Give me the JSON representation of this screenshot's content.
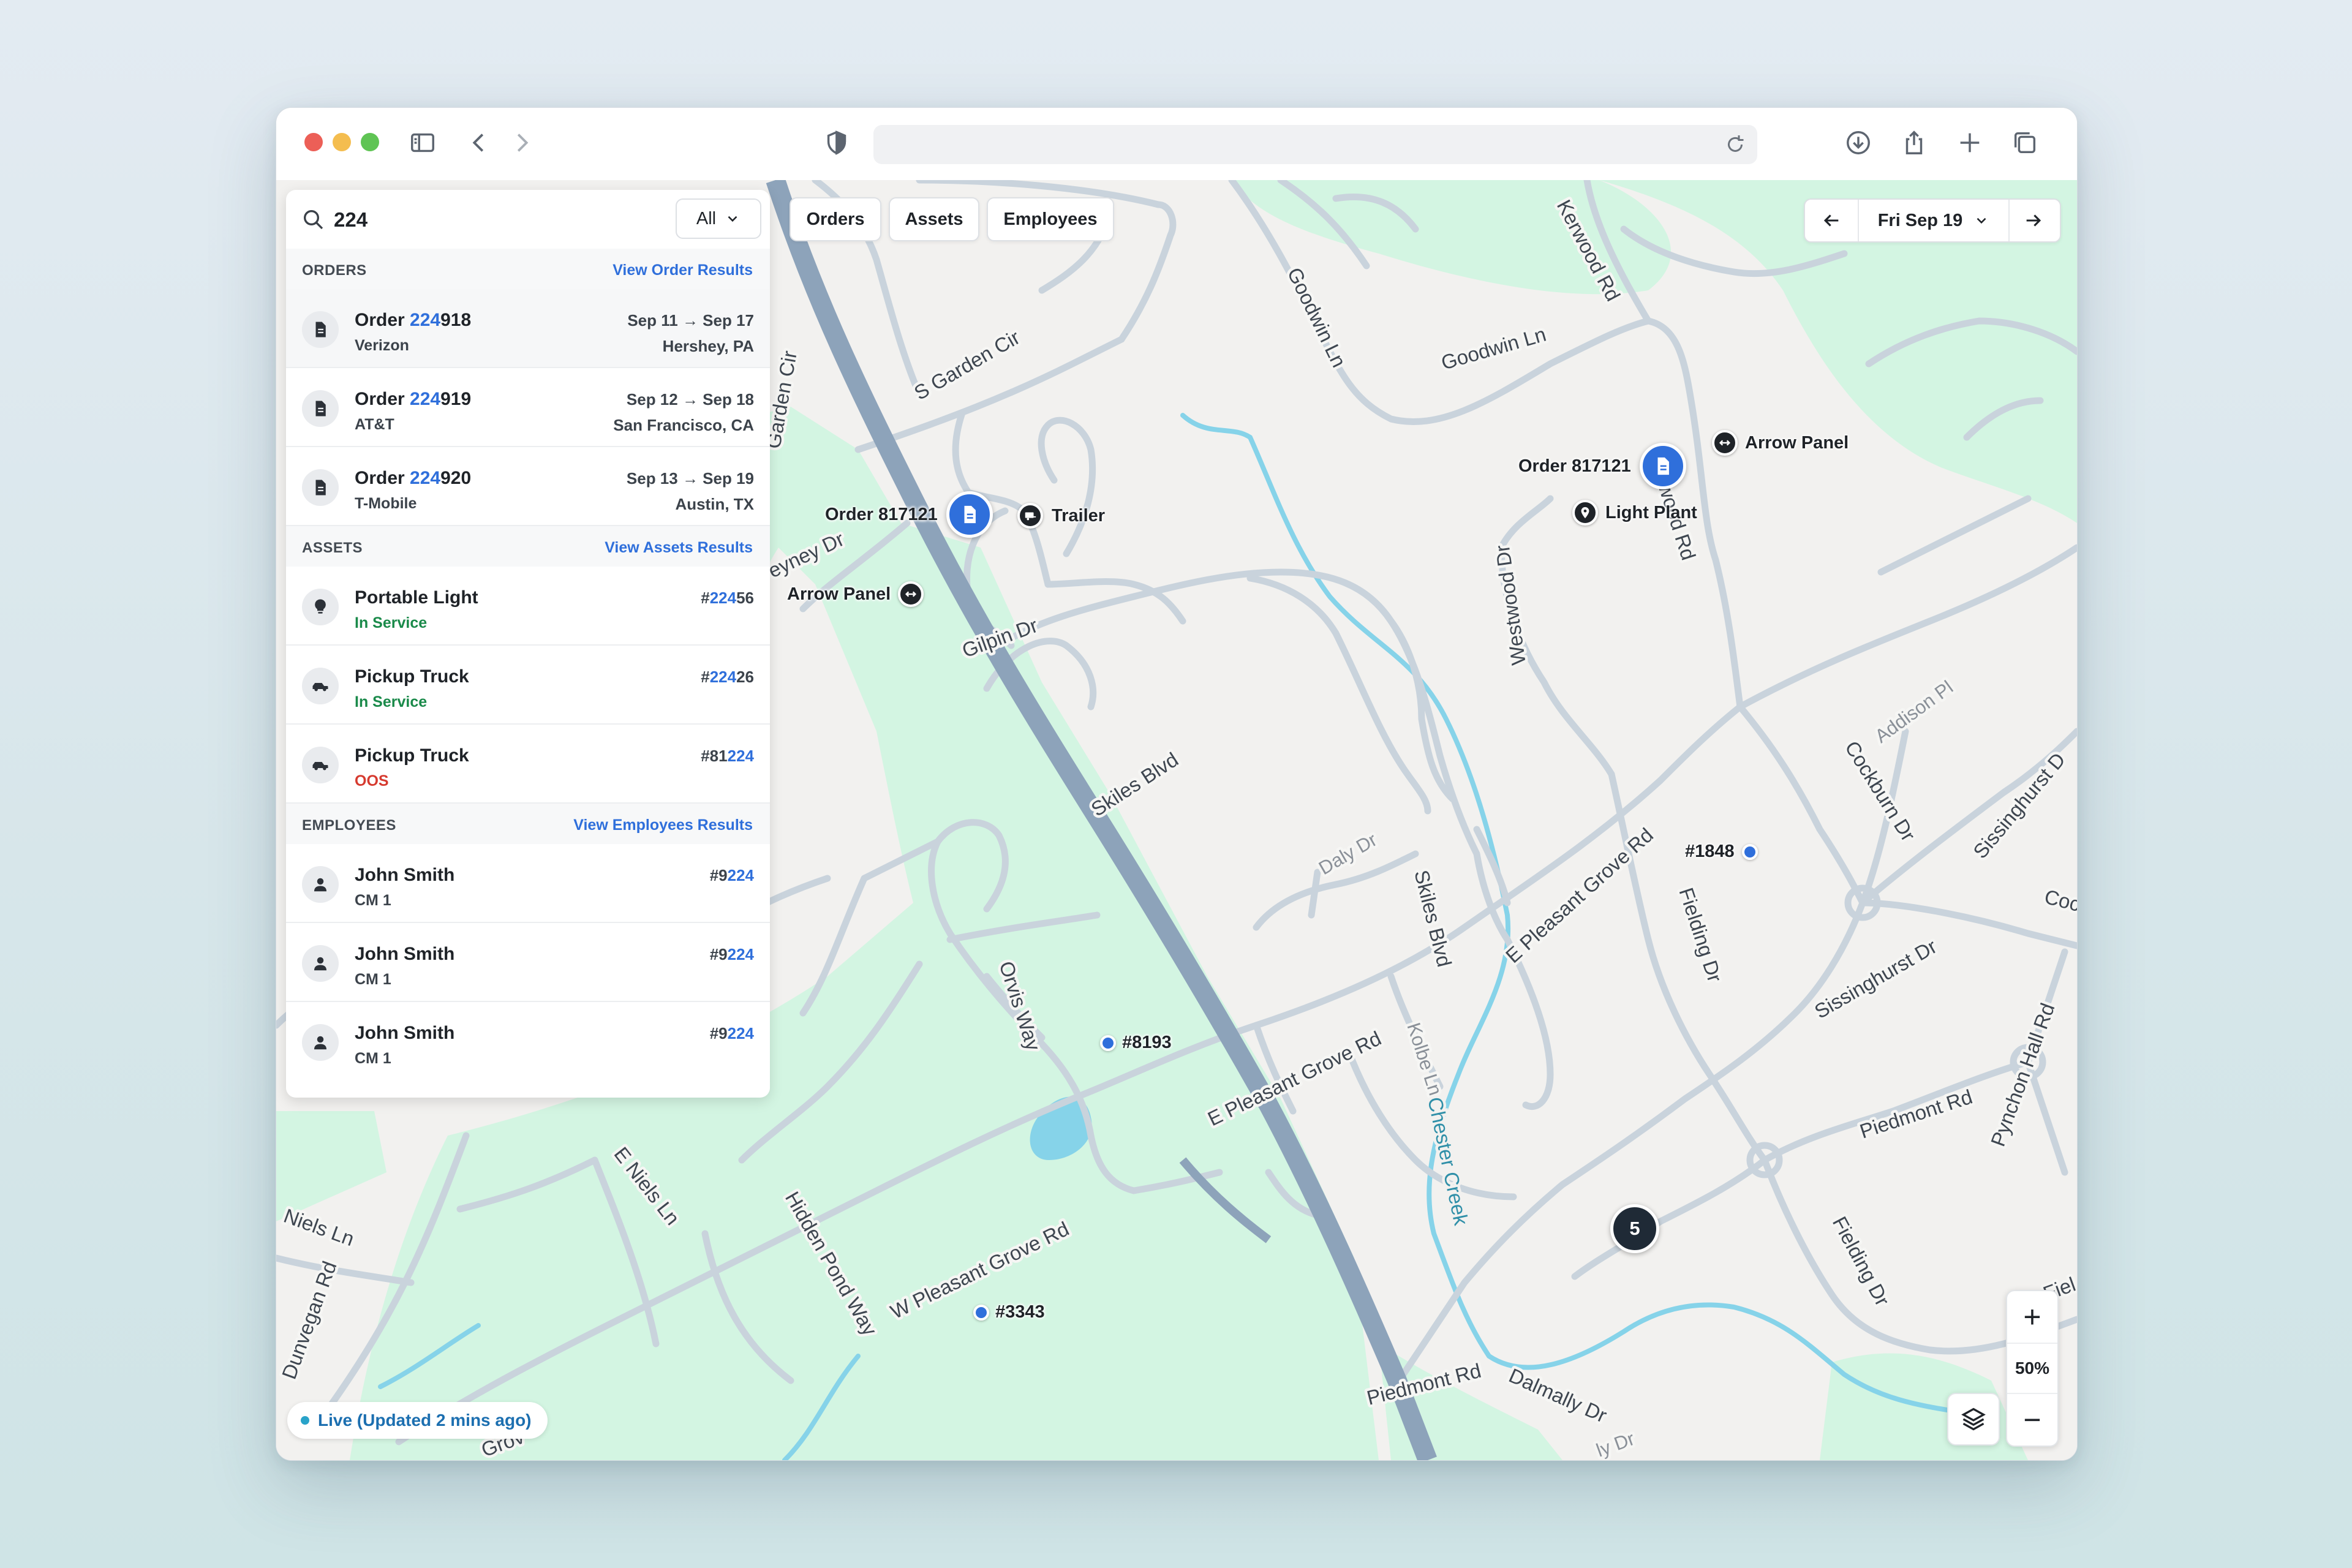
{
  "search": {
    "query": "224",
    "filter": "All"
  },
  "sections": {
    "orders": {
      "title": "ORDERS",
      "link": "View Order Results"
    },
    "assets": {
      "title": "ASSETS",
      "link": "View Assets Results"
    },
    "employees": {
      "title": "EMPLOYEES",
      "link": "View Employees Results"
    }
  },
  "orders": [
    {
      "prefix": "Order ",
      "hl": "224",
      "rest": "918",
      "sub": "Verizon",
      "dates": "Sep 11 → Sep 17",
      "place": "Hershey, PA"
    },
    {
      "prefix": "Order ",
      "hl": "224",
      "rest": "919",
      "sub": "AT&T",
      "dates": "Sep 12 → Sep 18",
      "place": "San Francisco, CA"
    },
    {
      "prefix": "Order ",
      "hl": "224",
      "rest": "920",
      "sub": "T-Mobile",
      "dates": "Sep 13 → Sep 19",
      "place": "Austin, TX"
    }
  ],
  "assets": [
    {
      "name": "Portable Light",
      "status": "In Service",
      "idpre": "#",
      "idhl": "224",
      "idrest": "56"
    },
    {
      "name": "Pickup Truck",
      "status": "In Service",
      "idpre": "#",
      "idhl": "224",
      "idrest": "26"
    },
    {
      "name": "Pickup Truck",
      "status": "OOS",
      "idpre": "#81",
      "idhl": "224",
      "idrest": ""
    }
  ],
  "employees": [
    {
      "name": "John Smith",
      "role": "CM 1",
      "idpre": "#9",
      "idhl": "224",
      "idrest": ""
    },
    {
      "name": "John Smith",
      "role": "CM 1",
      "idpre": "#9",
      "idhl": "224",
      "idrest": ""
    },
    {
      "name": "John Smith",
      "role": "CM 1",
      "idpre": "#9",
      "idhl": "224",
      "idrest": ""
    }
  ],
  "tabs": {
    "orders": "Orders",
    "assets": "Assets",
    "employees": "Employees"
  },
  "date": {
    "label": "Fri Sep 19"
  },
  "markers": {
    "order_a": "Order 817121",
    "order_b": "Order 817121",
    "trailer": "Trailer",
    "arrow_a": "Arrow Panel",
    "arrow_b": "Arrow Panel",
    "light_plant": "Light Plant",
    "unit_1848": "#1848",
    "unit_8193": "#8193",
    "unit_3343": "#3343",
    "cluster": "5"
  },
  "status": {
    "live": "Live (Updated 2 mins ago)"
  },
  "zoom": {
    "plus": "+",
    "level": "50%",
    "minus": "−"
  },
  "roads": {
    "garden_cir": "Garden Cir",
    "s_garden_cir": "S Garden Cir",
    "goodwin_ln_1": "Goodwin Ln",
    "goodwin_ln_2": "Goodwin Ln",
    "kerwood_rd_1": "Kerwood Rd",
    "kerwood_rd_2": "Kerwood Rd",
    "eyney_dr": "eyney Dr",
    "gilpin_dr": "Gilpin Dr",
    "westwood_dr": "Westwood Dr",
    "skiles_blvd_1": "Skiles Blvd",
    "skiles_blvd_2": "Skiles Blvd",
    "daly_dr": "Daly Dr",
    "addison_pl": "Addison Pl",
    "cockburn_dr": "Cockburn Dr",
    "sissinghurst_1": "Sissinghurst D",
    "sissinghurst_2": "Sissinghurst Dr",
    "e_pleasant_grove_1": "E Pleasant Grove Rd",
    "e_pleasant_grove_2": "E Pleasant Grove Rd",
    "fielding_dr_1": "Fielding Dr",
    "fielding_dr_2": "Fielding Dr",
    "fiel": "Fiel",
    "coc": "Coc",
    "orvis_way": "Orvis Way",
    "kolbe_ln": "Kolbe Ln",
    "chester_creek": "Chester Creek",
    "pynchon_hall": "Pynchon Hall Rd",
    "piedmont_rd_1": "Piedmont Rd",
    "piedmont_rd_2": "Piedmont Rd",
    "dalmally_dr": "Dalmally Dr",
    "e_niels_ln": "E Niels Ln",
    "niels_ln": "Niels Ln",
    "dunvegan_rd": "Dunvegan Rd",
    "hidden_pond": "Hidden Pond Way",
    "w_pleasant_grove": "W Pleasant Grove Rd",
    "grov": "Grov",
    "ly_dr": "ly Dr"
  },
  "colors": {
    "accent": "#2f6fdb",
    "park": "#d3f5e2",
    "road": "#c9d3dc",
    "highway": "#8da3ba",
    "water": "#86d3e9"
  },
  "icons": [
    "search-icon",
    "chevron-down-icon",
    "document-icon",
    "bulb-icon",
    "truck-icon",
    "person-icon",
    "arrow-left-icon",
    "arrow-right-icon",
    "layers-icon",
    "shield-icon",
    "download-icon",
    "share-icon",
    "plus-icon",
    "tabs-icon",
    "sidebar-icon",
    "reload-icon"
  ]
}
